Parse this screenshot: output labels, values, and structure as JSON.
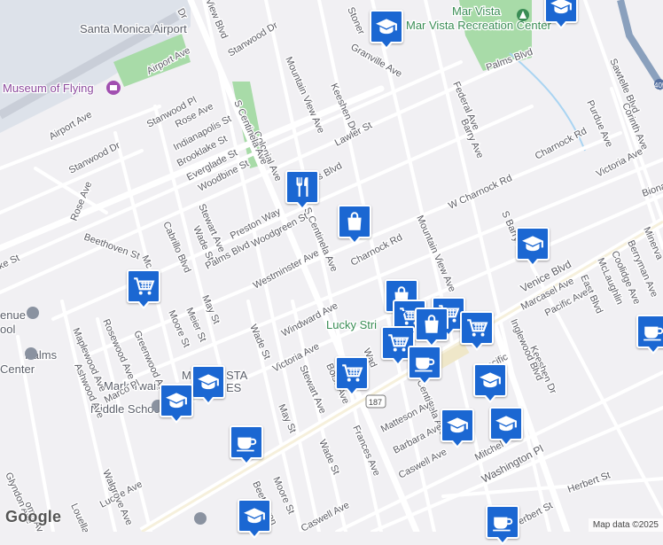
{
  "map": {
    "places": {
      "airport": "Santa Monica Airport",
      "museum": "Museum of Flying",
      "recreation": "Mar Vista Recreation Center",
      "lucky": "Lucky Stri",
      "school": "Mark Twain Middle School",
      "palms1": "Palms",
      "palms2": "Center",
      "marvista1": "M",
      "marvista2": "STA",
      "marvista3": "ES",
      "venue": "enue",
      "ool": "ool"
    },
    "streets": {
      "dr": "Dr",
      "view_blvd": "View Blvd",
      "airport_ave_n": "Airport Ave",
      "airport_ave_w": "Airport Ave",
      "stanwood_dr_n": "Stanwood Dr",
      "stanwood_pl": "Stanwood Pl",
      "stanwood_dr_w": "Stanwood Dr",
      "rose_ave_n": "Rose Ave",
      "rose_ave_w": "Rose Ave",
      "indianapolis": "Indianapolis St",
      "brooklake": "Brooklake St",
      "everglade": "Everglade St",
      "woodbine": "Woodbine St",
      "colonial": "Colonial Ave",
      "centinela_n": "S Centinela Ave",
      "centinela_mid": "S Centinela Ave",
      "centinela_s": "S Centinela Ave",
      "preston": "Preston Way",
      "stewart_n": "Stewart Ave",
      "stewart_s": "Stewart Ave",
      "wade_n": "Wade St",
      "wade_mid": "Wade St",
      "wade_s": "Wade St",
      "wade_e": "Wad",
      "cabrillo": "Cabrillo Blvd",
      "palms_blvd_w": "Palms Blvd",
      "palms_blvd_n": "Palms Blvd",
      "palms_blvd_e": "Palms Blvd",
      "woodgreen": "Woodgreen St",
      "westminster": "Westminster Ave",
      "beethoven_n": "Beethoven St",
      "beethoven_s": "Beethoven",
      "ke_st": "ke St",
      "mountain_view_n": "Mountain View Ave",
      "mountain_view_s": "Mountain View Ave",
      "stoner": "Stoner",
      "granville": "Granville Ave",
      "keeshen_n": "Keeshen Dr",
      "keeshen_s": "Keeshen Dr",
      "lawler": "Lawler St",
      "federal": "Federal Ave",
      "barry_n": "Barry Ave",
      "barry_s": "S Barry Ave",
      "w_charnock": "W Charnock Rd",
      "charnock": "Charnock Rd",
      "charnock_e": "Charnock Rd",
      "sawtelle": "Sawtelle Blvd",
      "purdue": "Purdue Ave",
      "corinth": "Corinth Ave",
      "victoria_e": "Victoria Ave",
      "victoria_w": "Victoria Ave",
      "bionda": "Biona",
      "minerva": "Minerva",
      "berryman": "Berryman Ave",
      "coolidge": "Coolidge Ave",
      "mclaughlin": "McLaughlin",
      "east_blvd": "East Blvd",
      "pacific_e": "Pacific Ave",
      "pacific_s": "Pacific",
      "venice": "Venice Blvd",
      "marcasel": "Marcasel Ave",
      "inglewood": "Inglewood Blvd",
      "windward": "Windward Ave",
      "may_n": "May St",
      "may_s": "May St",
      "meier": "Meier St",
      "moore_n": "Moore St",
      "moore_s": "Moore St",
      "maplewood": "Maplewood Ave",
      "rosewood": "Rosewood Ave",
      "greenwood": "Greenwood Ave",
      "ashwood": "Ashwood Ave",
      "marco": "Marco Pl",
      "boise": "Boise Ave",
      "frances": "Frances Ave",
      "matteson": "Matteson Ave",
      "barbara": "Barbara Ave",
      "caswell_e": "Caswell Ave",
      "caswell_w": "Caswell Ave",
      "mitchell": "Mitchel",
      "washington": "Washington Pl",
      "herbert_e": "Herbert St",
      "herbert_w": "Herbert St",
      "lucille": "Lucille Ave",
      "walgrove": "Walgrove Ave",
      "glyndon": "Glyndon Ave",
      "loma": "oma Ave",
      "louella": "Louella",
      "mc": "Mc",
      "route": "187",
      "freeway": "405"
    },
    "colors": {
      "background": "#f1f0f3",
      "road": "#ffffff",
      "freeway": "#8aa0bd",
      "airport": "#dde2ea",
      "park": "#a8dba8",
      "pin": "#1b67d2",
      "water": "#a9d4f2"
    }
  },
  "pins": [
    {
      "icon": "school-icon"
    },
    {
      "icon": "school-icon"
    },
    {
      "icon": "restaurant-icon"
    },
    {
      "icon": "shopping-bag-icon"
    },
    {
      "icon": "school-icon"
    },
    {
      "icon": "shopping-cart-icon"
    },
    {
      "icon": "shopping-bag-icon"
    },
    {
      "icon": "shopping-cart-icon"
    },
    {
      "icon": "shopping-cart-icon"
    },
    {
      "icon": "shopping-bag-icon"
    },
    {
      "icon": "shopping-cart-icon"
    },
    {
      "icon": "shopping-cart-icon"
    },
    {
      "icon": "coffee-cup-icon"
    },
    {
      "icon": "shopping-cart-icon"
    },
    {
      "icon": "coffee-cup-icon"
    },
    {
      "icon": "school-icon"
    },
    {
      "icon": "school-icon"
    },
    {
      "icon": "school-icon"
    },
    {
      "icon": "school-icon"
    },
    {
      "icon": "coffee-cup-icon"
    },
    {
      "icon": "coffee-cup-icon"
    },
    {
      "icon": "school-icon"
    },
    {
      "icon": "coffee-cup-icon"
    }
  ],
  "footer": {
    "logo": "Google",
    "attribution": "Map data ©2025"
  }
}
